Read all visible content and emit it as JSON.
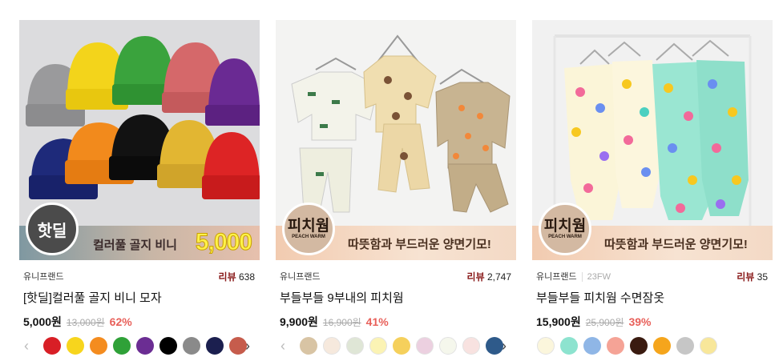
{
  "products": [
    {
      "banner_text": "컬러풀 골지 비니",
      "banner_price": "5,000",
      "badge": "핫딜",
      "brand": "유니프랜드",
      "review_label": "리뷰",
      "review_count": "638",
      "title": "[핫딜]컬러풀 골지 비니 모자",
      "sale_price": "5,000원",
      "original_price": "13,000원",
      "discount": "62%",
      "swatches": [
        "#d81f26",
        "#f7d51d",
        "#f48c1f",
        "#2fa138",
        "#6b2d93",
        "#000000",
        "#8a8a8a",
        "#1b1f4f",
        "#c65c4c"
      ],
      "icons": {
        "prev": "chevron-left-icon",
        "next": "chevron-right-icon"
      }
    },
    {
      "banner_text": "따뜻함과 부드러운 양면기모!",
      "badge_title": "피치웜",
      "badge_sub": "PEACH WARM",
      "brand": "유니프랜드",
      "review_label": "리뷰",
      "review_count": "2,747",
      "title": "부들부들 9부내의 피치웜",
      "sale_price": "9,900원",
      "original_price": "16,900원",
      "discount": "41%",
      "swatches": [
        "#d8c4a4",
        "#f6e9dd",
        "#dfe6d6",
        "#fbf3b4",
        "#f5d05c",
        "#ecd0e0",
        "#f5f7ec",
        "#f8e2e0",
        "#2e5a8a"
      ],
      "icons": {
        "prev": "chevron-left-icon",
        "next": "chevron-right-icon"
      }
    },
    {
      "banner_text": "따뜻함과 부드러운 양면기모!",
      "badge_title": "피치웜",
      "badge_sub": "PEACH WARM",
      "brand": "유니프랜드",
      "season": "23FW",
      "review_label": "리뷰",
      "review_count": "35",
      "title": "부들부들 피치웜 수면잠옷",
      "sale_price": "15,900원",
      "original_price": "25,900원",
      "discount": "39%",
      "swatches": [
        "#fbf6dc",
        "#8de3cf",
        "#8fb6e6",
        "#f5a396",
        "#3a1b10",
        "#f5a51c",
        "#c6c6c6",
        "#f8e79a"
      ]
    }
  ]
}
